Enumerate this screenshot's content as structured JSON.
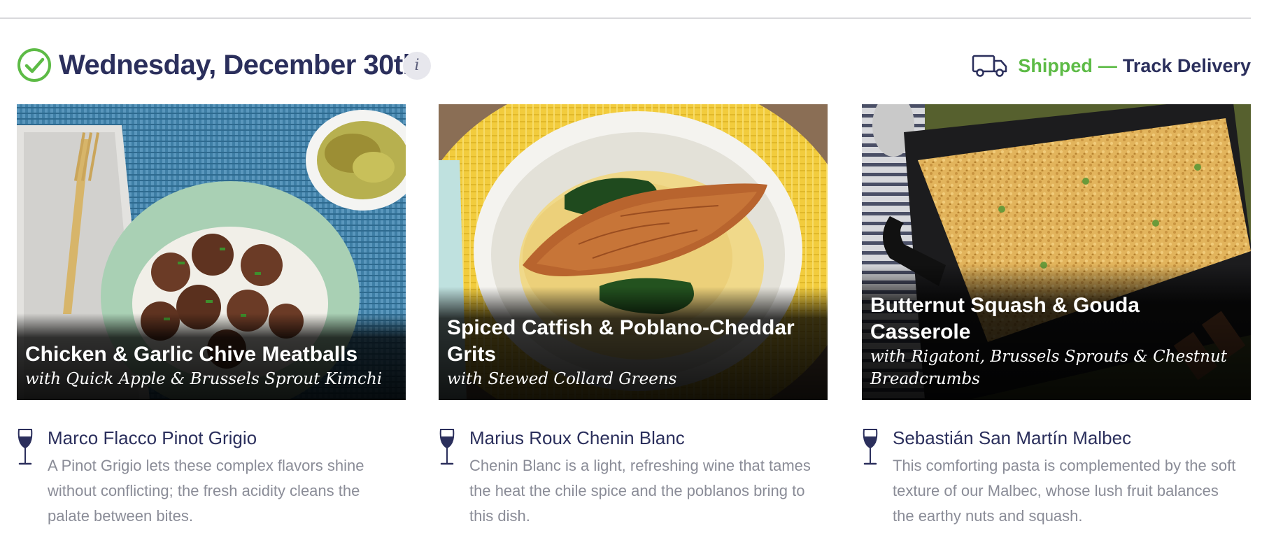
{
  "header": {
    "date": "Wednesday, December 30th",
    "info_label": "i",
    "status": "Shipped",
    "separator": "—",
    "track_label": "Track Delivery"
  },
  "colors": {
    "navy": "#2b2f5c",
    "green": "#5dbb46",
    "muted_text": "#8a8c97"
  },
  "icons": {
    "check": "check-circle-icon",
    "info": "info-icon",
    "truck": "truck-icon",
    "wine": "wine-glass-icon"
  },
  "meals": [
    {
      "title": "Chicken & Garlic Chive Meatballs",
      "subtitle": "with Quick Apple & Brussels Sprout Kimchi",
      "wine_name": "Marco Flacco Pinot Grigio",
      "wine_desc": "A Pinot Grigio lets these complex flavors shine without conflicting; the fresh acidity cleans the palate between bites."
    },
    {
      "title": "Spiced Catfish & Poblano-Cheddar Grits",
      "subtitle": "with Stewed Collard Greens",
      "wine_name": "Marius Roux Chenin Blanc",
      "wine_desc": "Chenin Blanc is a light, refreshing wine that tames the heat the chile spice and the poblanos bring to this dish."
    },
    {
      "title": "Butternut Squash & Gouda Casserole",
      "subtitle": "with Rigatoni, Brussels Sprouts & Chestnut Breadcrumbs",
      "wine_name": "Sebastián San Martín Malbec",
      "wine_desc": "This comforting pasta is complemented by the soft texture of our Malbec, whose lush fruit balances the earthy nuts and squash."
    }
  ]
}
